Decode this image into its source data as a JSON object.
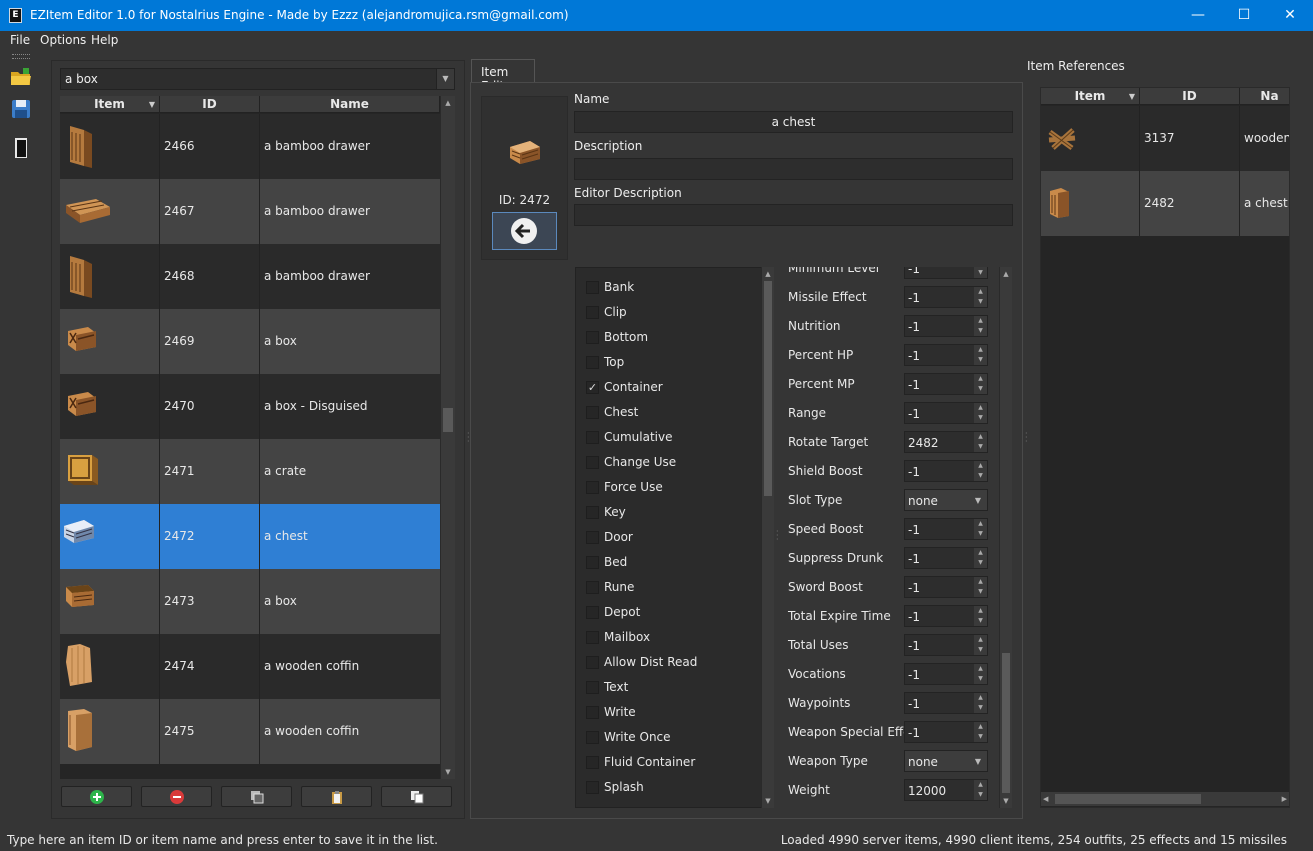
{
  "window": {
    "title": "EZItem Editor 1.0 for Nostalrius Engine - Made by Ezzz (alejandromujica.rsm@gmail.com)",
    "minimize": "—",
    "maximize": "☐",
    "close": "✕",
    "icon_letter": "E"
  },
  "menu": [
    "File",
    "Options",
    "Help"
  ],
  "toolbar": {
    "icons": [
      "open-folder-icon",
      "save-icon",
      "app-icon"
    ]
  },
  "search": {
    "value": "a box"
  },
  "items_table": {
    "columns": [
      "Item",
      "ID",
      "Name"
    ],
    "rows": [
      {
        "id": "2466",
        "name": "a bamboo drawer",
        "selected": false
      },
      {
        "id": "2467",
        "name": "a bamboo drawer",
        "selected": false
      },
      {
        "id": "2468",
        "name": "a bamboo drawer",
        "selected": false
      },
      {
        "id": "2469",
        "name": "a box",
        "selected": false
      },
      {
        "id": "2470",
        "name": "a box - Disguised",
        "selected": false
      },
      {
        "id": "2471",
        "name": "a crate",
        "selected": false
      },
      {
        "id": "2472",
        "name": "a chest",
        "selected": true
      },
      {
        "id": "2473",
        "name": "a box",
        "selected": false
      },
      {
        "id": "2474",
        "name": "a wooden coffin",
        "selected": false
      },
      {
        "id": "2475",
        "name": "a wooden coffin",
        "selected": false
      }
    ]
  },
  "list_buttons": [
    "add-icon",
    "remove-icon",
    "duplicate-icon",
    "paste-icon",
    "copy-icon"
  ],
  "item_edit": {
    "tab": "Item Edit",
    "id_label": "ID: 2472",
    "name_label": "Name",
    "name_value": "a chest",
    "description_label": "Description",
    "description_value": "",
    "editor_description_label": "Editor Description",
    "editor_description_value": ""
  },
  "flags": [
    {
      "label": "Bank",
      "checked": false
    },
    {
      "label": "Clip",
      "checked": false
    },
    {
      "label": "Bottom",
      "checked": false
    },
    {
      "label": "Top",
      "checked": false
    },
    {
      "label": "Container",
      "checked": true
    },
    {
      "label": "Chest",
      "checked": false
    },
    {
      "label": "Cumulative",
      "checked": false
    },
    {
      "label": "Change Use",
      "checked": false
    },
    {
      "label": "Force Use",
      "checked": false
    },
    {
      "label": "Key",
      "checked": false
    },
    {
      "label": "Door",
      "checked": false
    },
    {
      "label": "Bed",
      "checked": false
    },
    {
      "label": "Rune",
      "checked": false
    },
    {
      "label": "Depot",
      "checked": false
    },
    {
      "label": "Mailbox",
      "checked": false
    },
    {
      "label": "Allow Dist Read",
      "checked": false
    },
    {
      "label": "Text",
      "checked": false
    },
    {
      "label": "Write",
      "checked": false
    },
    {
      "label": "Write Once",
      "checked": false
    },
    {
      "label": "Fluid Container",
      "checked": false
    },
    {
      "label": "Splash",
      "checked": false
    }
  ],
  "attributes": [
    {
      "label": "Minimum Level",
      "value": "-1",
      "type": "spin"
    },
    {
      "label": "Missile Effect",
      "value": "-1",
      "type": "spin"
    },
    {
      "label": "Nutrition",
      "value": "-1",
      "type": "spin"
    },
    {
      "label": "Percent HP",
      "value": "-1",
      "type": "spin"
    },
    {
      "label": "Percent MP",
      "value": "-1",
      "type": "spin"
    },
    {
      "label": "Range",
      "value": "-1",
      "type": "spin"
    },
    {
      "label": "Rotate Target",
      "value": "2482",
      "type": "spin"
    },
    {
      "label": "Shield Boost",
      "value": "-1",
      "type": "spin"
    },
    {
      "label": "Slot Type",
      "value": "none",
      "type": "select"
    },
    {
      "label": "Speed Boost",
      "value": "-1",
      "type": "spin"
    },
    {
      "label": "Suppress Drunk",
      "value": "-1",
      "type": "spin"
    },
    {
      "label": "Sword Boost",
      "value": "-1",
      "type": "spin"
    },
    {
      "label": "Total Expire Time",
      "value": "-1",
      "type": "spin"
    },
    {
      "label": "Total Uses",
      "value": "-1",
      "type": "spin"
    },
    {
      "label": "Vocations",
      "value": "-1",
      "type": "spin"
    },
    {
      "label": "Waypoints",
      "value": "-1",
      "type": "spin"
    },
    {
      "label": "Weapon Special Effect",
      "value": "-1",
      "type": "spin"
    },
    {
      "label": "Weapon Type",
      "value": "none",
      "type": "select"
    },
    {
      "label": "Weight",
      "value": "12000",
      "type": "spin"
    }
  ],
  "references": {
    "title": "Item References",
    "columns": [
      "Item",
      "ID",
      "Na"
    ],
    "rows": [
      {
        "id": "3137",
        "name": "wooden tr"
      },
      {
        "id": "2482",
        "name": "a chest"
      }
    ]
  },
  "status": {
    "left": "Type here an item ID or item name and press enter to save it in the list.",
    "right": "Loaded 4990 server items, 4990 client items, 254 outfits, 25 effects and 15 missiles"
  },
  "colors": {
    "accent": "#0078d7",
    "selection": "#2f7fd4",
    "background": "#353535"
  }
}
